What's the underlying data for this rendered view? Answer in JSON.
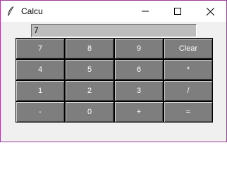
{
  "window": {
    "title": "Calcu",
    "border_color": "#9b3f9b"
  },
  "display": {
    "value": "7",
    "background": "#bdbdbd"
  },
  "keys": [
    [
      "7",
      "8",
      "9",
      "Clear"
    ],
    [
      "4",
      "5",
      "6",
      "*"
    ],
    [
      "1",
      "2",
      "3",
      "/"
    ],
    [
      "-",
      "0",
      "+",
      "="
    ]
  ],
  "colors": {
    "key_background": "#7e7e7e",
    "key_text": "#ffffff"
  },
  "icons": {
    "app": "feather-icon",
    "minimize": "minimize-icon",
    "maximize": "maximize-icon",
    "close": "close-icon"
  }
}
